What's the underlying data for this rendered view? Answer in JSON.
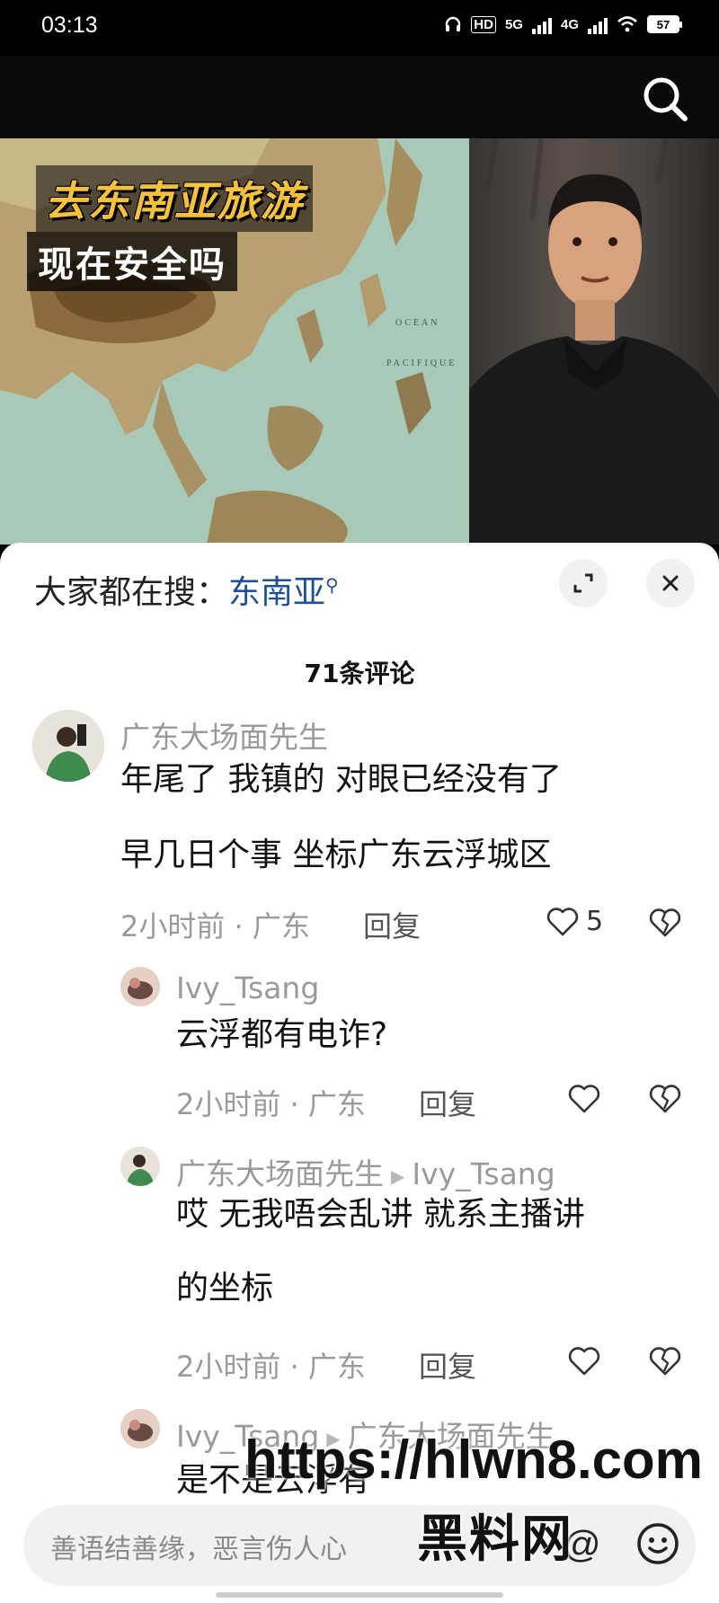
{
  "status_bar": {
    "time": "03:13",
    "network_hd": "HD",
    "network_5g": "5G",
    "network_4g": "4G",
    "battery": "57"
  },
  "video": {
    "title_line1": "去东南亚旅游",
    "title_line2": "现在安全吗",
    "map_label_ocean": "OCEAN",
    "map_label_pacifique": "PACIFIQUE"
  },
  "sheet": {
    "search_prefix": "大家都在搜：",
    "search_keyword": "东南亚",
    "comment_count": "71条评论"
  },
  "comments": [
    {
      "author": "广东大场面先生",
      "lines": [
        "年尾了 我镇的 对眼已经没有了",
        "早几日个事 坐标广东云浮城区"
      ],
      "meta": "2小时前 · 广东",
      "reply": "回复",
      "likes": "5"
    },
    {
      "author": "Ivy_Tsang",
      "lines": [
        "云浮都有电诈?"
      ],
      "meta": "2小时前 · 广东",
      "reply": "回复",
      "likes": ""
    },
    {
      "author": "广东大场面先生",
      "reply_to": "Ivy_Tsang",
      "lines": [
        "哎 无我唔会乱讲  就系主播讲",
        "的坐标"
      ],
      "meta": "2小时前 · 广东",
      "reply": "回复",
      "likes": ""
    },
    {
      "author": "Ivy_Tsang",
      "reply_to": "广东大场面先生",
      "lines": [
        "是不是云浮有"
      ]
    }
  ],
  "input": {
    "placeholder": "善语结善缘，恶言伤人心",
    "at_symbol": "@"
  },
  "watermark": {
    "url": "https://hlwn8.com",
    "name": "黑料网"
  },
  "icons": [
    "search-icon",
    "expand-icon",
    "close-icon",
    "heart-icon",
    "broken-heart-icon",
    "emoji-icon"
  ]
}
